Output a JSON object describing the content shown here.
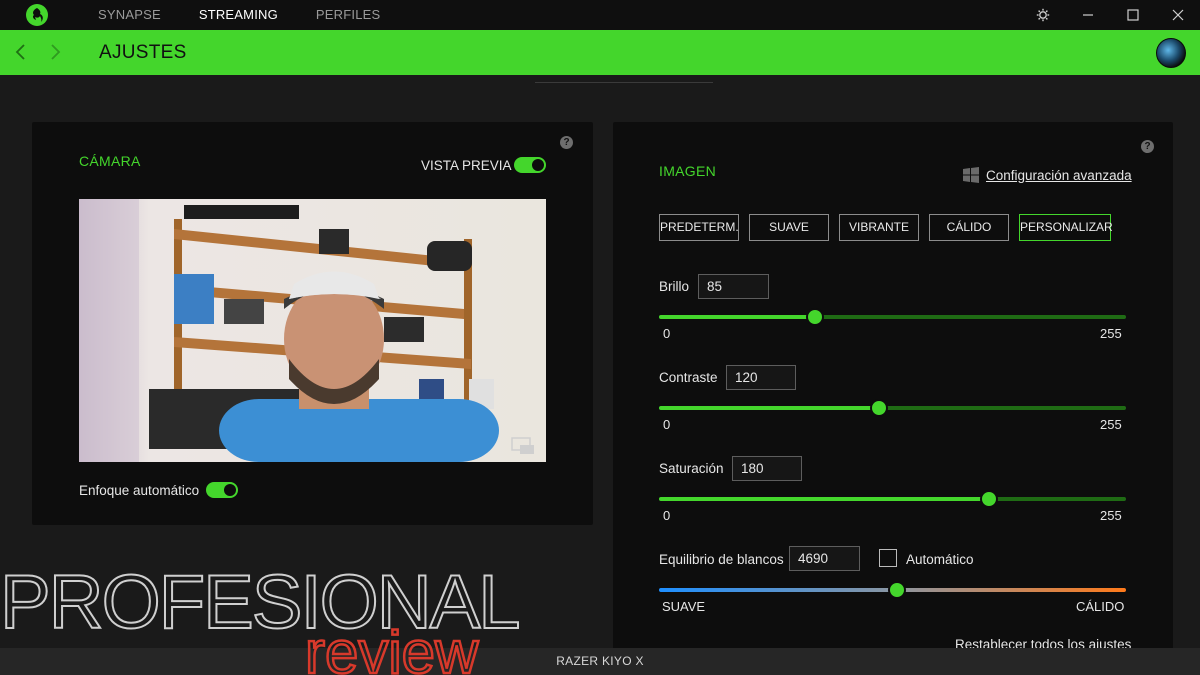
{
  "topnav": {
    "tabs": [
      {
        "label": "SYNAPSE",
        "active": false
      },
      {
        "label": "STREAMING",
        "active": true
      },
      {
        "label": "PERFILES",
        "active": false
      }
    ]
  },
  "header": {
    "title": "AJUSTES"
  },
  "camera": {
    "title": "CÁMARA",
    "preview_label": "VISTA PREVIA",
    "preview_on": true,
    "autofocus_label": "Enfoque automático",
    "autofocus_on": true
  },
  "image": {
    "title": "IMAGEN",
    "advanced_link": "Configuración avanzada",
    "presets": [
      "PREDETERM.",
      "SUAVE",
      "VIBRANTE",
      "CÁLIDO",
      "PERSONALIZAR"
    ],
    "active_preset": "PERSONALIZAR",
    "brightness": {
      "label": "Brillo",
      "value": "85",
      "min": "0",
      "max": "255"
    },
    "contrast": {
      "label": "Contraste",
      "value": "120",
      "min": "0",
      "max": "255"
    },
    "saturation": {
      "label": "Saturación",
      "value": "180",
      "min": "0",
      "max": "255"
    },
    "white_balance": {
      "label": "Equilibrio de blancos",
      "value": "4690",
      "auto_label": "Automático",
      "auto_checked": false,
      "min_label": "SUAVE",
      "max_label": "CÁLIDO",
      "position": 0.51
    },
    "reset_label": "Restablecer todos los ajustes"
  },
  "statusbar": {
    "device": "RAZER KIYO X"
  },
  "watermark": {
    "line1": "PROFESIONAL",
    "line2": "review"
  },
  "colors": {
    "accent": "#44d62c",
    "dark": "#0d0d0d",
    "warm": "#ff7a1a",
    "cool": "#1e8fff"
  }
}
